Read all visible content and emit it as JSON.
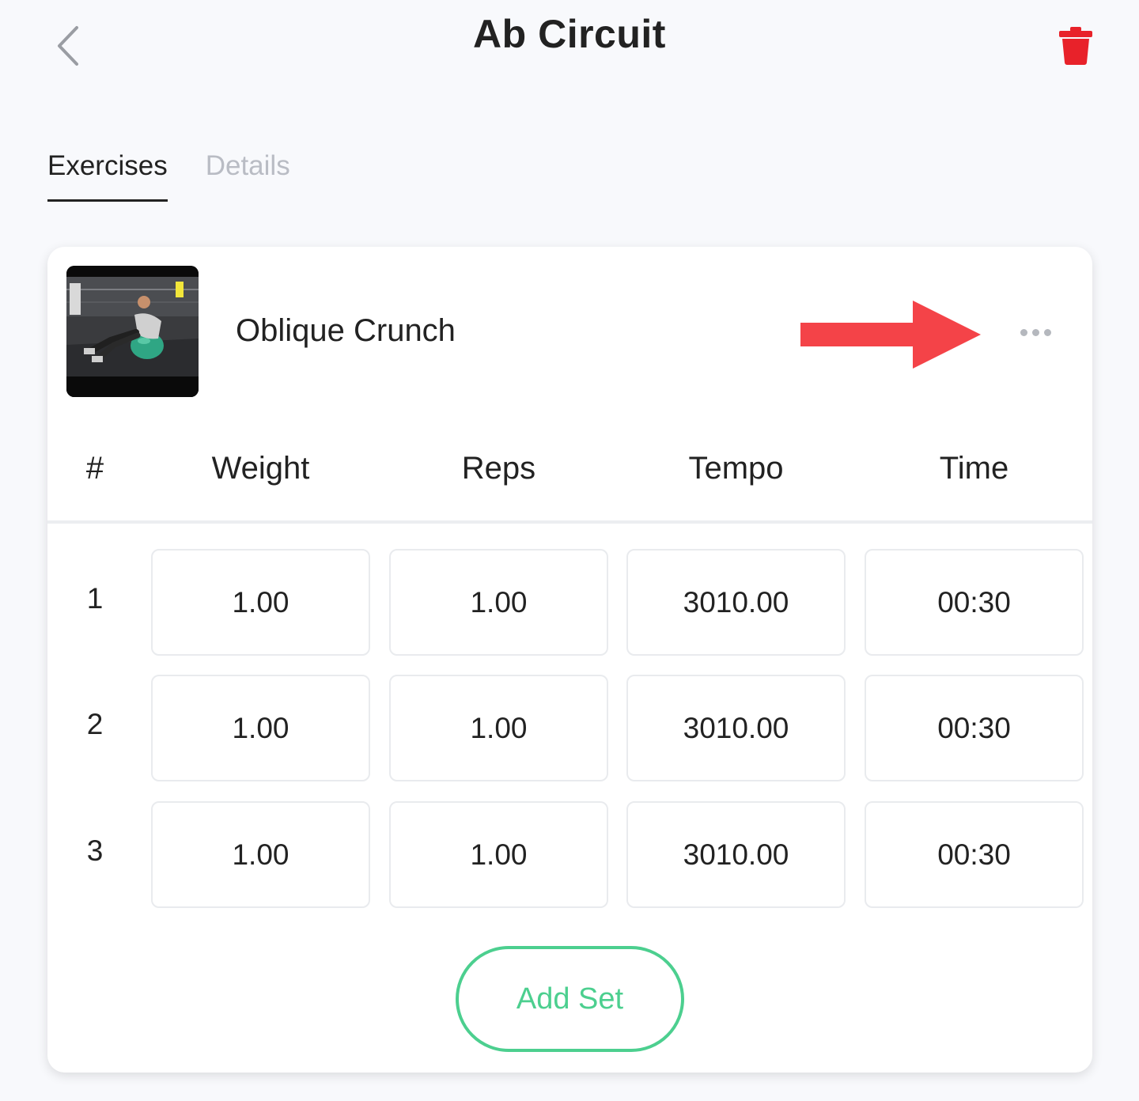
{
  "header": {
    "title": "Ab Circuit"
  },
  "tabs": [
    {
      "label": "Exercises",
      "active": true
    },
    {
      "label": "Details",
      "active": false
    }
  ],
  "exercise": {
    "name": "Oblique Crunch",
    "columns": [
      "#",
      "Weight",
      "Reps",
      "Tempo",
      "Time"
    ],
    "sets": [
      {
        "number": "1",
        "weight": "1.00",
        "reps": "1.00",
        "tempo": "3010.00",
        "time": "00:30"
      },
      {
        "number": "2",
        "weight": "1.00",
        "reps": "1.00",
        "tempo": "3010.00",
        "time": "00:30"
      },
      {
        "number": "3",
        "weight": "1.00",
        "reps": "1.00",
        "tempo": "3010.00",
        "time": "00:30"
      }
    ],
    "add_set_label": "Add Set"
  },
  "icons": {
    "back": "chevron-left-icon",
    "delete": "trash-icon",
    "more": "more-horizontal-icon",
    "annotation": "red-arrow-icon"
  },
  "colors": {
    "delete": "#e8222a",
    "accent_green": "#4ccf8f",
    "annotation_arrow": "#f44348",
    "inactive_tab": "#b9bcc4"
  }
}
